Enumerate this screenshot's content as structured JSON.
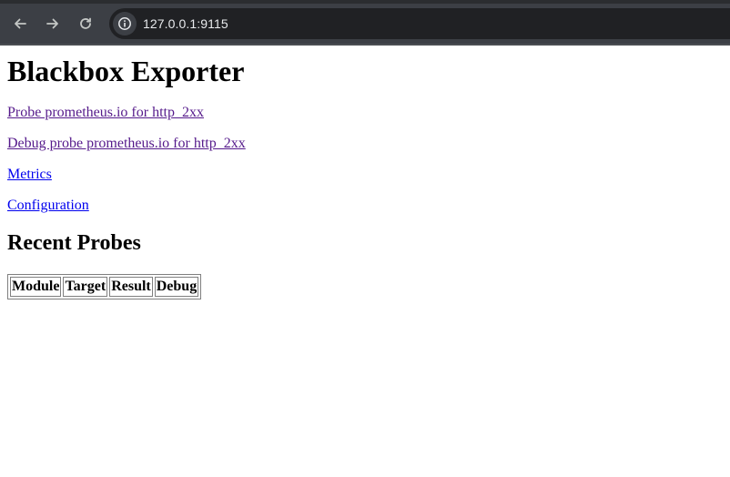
{
  "browser": {
    "url": "127.0.0.1:9115",
    "back_icon": "arrow-left-icon",
    "forward_icon": "arrow-right-icon",
    "reload_icon": "reload-icon",
    "site_info_icon": "info-icon"
  },
  "page": {
    "title": "Blackbox Exporter",
    "links": [
      {
        "label": "Probe prometheus.io for http_2xx",
        "state": "visited"
      },
      {
        "label": "Debug probe prometheus.io for http_2xx",
        "state": "visited"
      },
      {
        "label": "Metrics",
        "state": "unvisited"
      },
      {
        "label": "Configuration",
        "state": "unvisited"
      }
    ],
    "recent_heading": "Recent Probes",
    "table": {
      "headers": [
        "Module",
        "Target",
        "Result",
        "Debug"
      ],
      "rows": []
    }
  },
  "colors": {
    "visited_link": "#551a8b",
    "unvisited_link": "#0000ee",
    "toolbar": "#3c3f45",
    "omnibox": "#202124"
  }
}
